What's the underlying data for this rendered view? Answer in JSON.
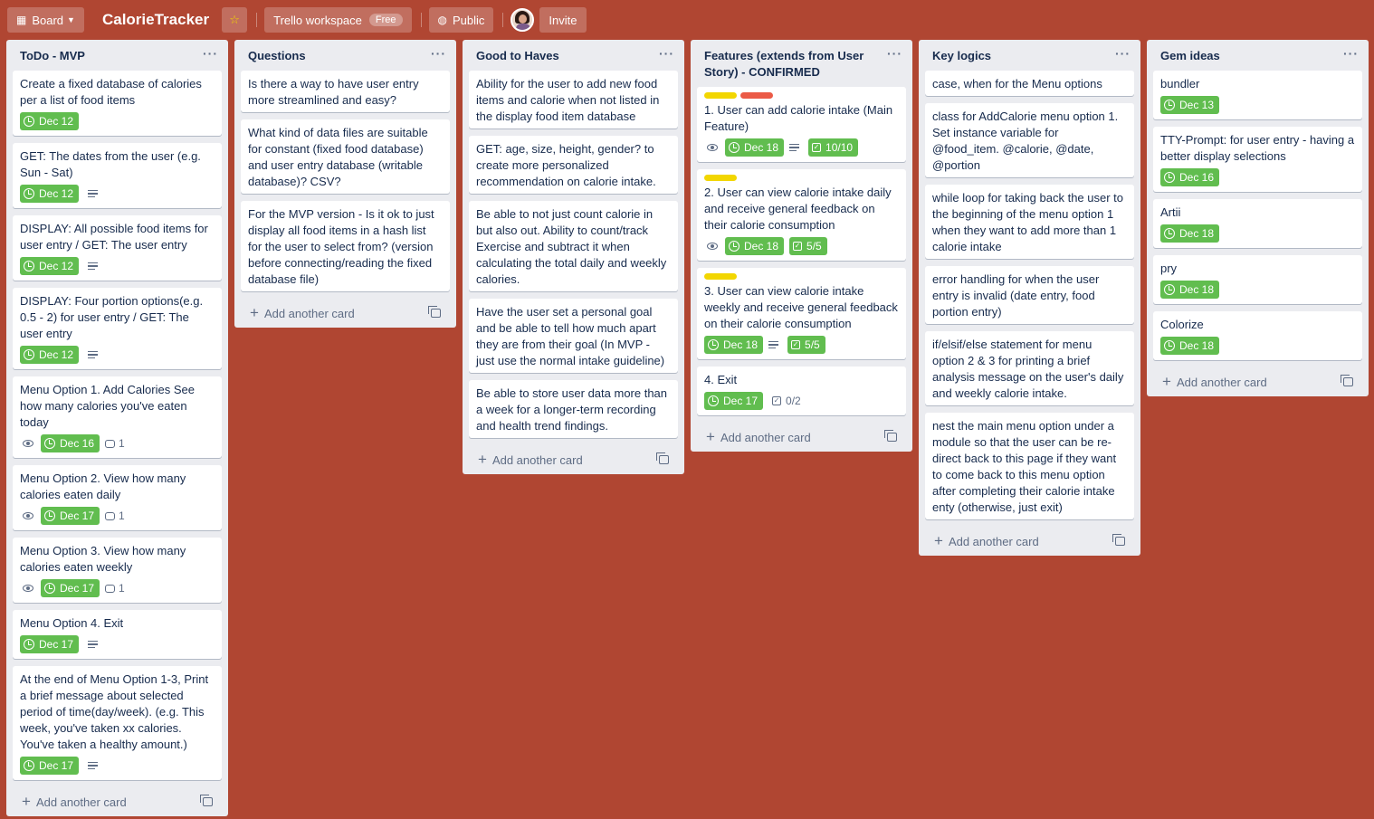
{
  "header": {
    "board_btn": "Board",
    "title": "CalorieTracker",
    "workspace": "Trello workspace",
    "workspace_badge": "Free",
    "visibility": "Public",
    "invite": "Invite"
  },
  "lists": [
    {
      "title": "ToDo - MVP",
      "add": "Add another card",
      "cards": [
        {
          "text": "Create a fixed database of calories per a list of food items",
          "due": "Dec 12"
        },
        {
          "text": "GET: The dates from the user (e.g. Sun - Sat)",
          "due": "Dec 12"
        },
        {
          "text": "DISPLAY: All possible food items for user entry / GET: The user entry",
          "due": "Dec 12"
        },
        {
          "text": "DISPLAY: Four portion options(e.g. 0.5 - 2) for user entry / GET: The user entry",
          "due": "Dec 12"
        },
        {
          "text": "Menu Option 1. Add Calories See how many calories you've eaten today",
          "due": "Dec 16",
          "comments": "1"
        },
        {
          "text": "Menu Option 2. View how many calories eaten daily",
          "due": "Dec 17",
          "comments": "1"
        },
        {
          "text": "Menu Option 3. View how many calories eaten weekly",
          "due": "Dec 17",
          "comments": "1"
        },
        {
          "text": "Menu Option 4. Exit",
          "due": "Dec 17"
        },
        {
          "text": "At the end of Menu Option 1-3, Print a brief message about selected period of time(day/week). (e.g. This week, you've taken xx calories. You've taken a healthy amount.)",
          "due": "Dec 17"
        }
      ]
    },
    {
      "title": "Questions",
      "add": "Add another card",
      "cards": [
        {
          "text": "Is there a way to have user entry more streamlined and easy?"
        },
        {
          "text": "What kind of data files are suitable for constant (fixed food database) and user entry database (writable database)? CSV?"
        },
        {
          "text": "For the MVP version - Is it ok to just display all food items in a hash list for the user to select from? (version before connecting/reading the fixed database file)"
        }
      ]
    },
    {
      "title": "Good to Haves",
      "add": "Add another card",
      "cards": [
        {
          "text": "Ability for the user to add new food items and calorie when not listed in the display food item database"
        },
        {
          "text": "GET: age, size, height, gender? to create more personalized recommendation on calorie intake."
        },
        {
          "text": "Be able to not just count calorie in but also out. Ability to count/track Exercise and subtract it when calculating the total daily and weekly calories."
        },
        {
          "text": "Have the user set a personal goal and be able to tell how much apart they are from their goal (In MVP - just use the normal intake guideline)"
        },
        {
          "text": "Be able to store user data more than a week for a longer-term recording and health trend findings."
        }
      ]
    },
    {
      "title": "Features (extends from User Story) - CONFIRMED",
      "add": "Add another card",
      "cards": [
        {
          "text": "1. User can add calorie intake (Main Feature)",
          "due": "Dec 18",
          "checklist": "10/10"
        },
        {
          "text": "2. User can view calorie intake daily and receive general feedback on their calorie consumption",
          "due": "Dec 18",
          "checklist": "5/5"
        },
        {
          "text": "3. User can view calorie intake weekly and receive general feedback on their calorie consumption",
          "due": "Dec 18",
          "checklist": "5/5"
        },
        {
          "text": "4. Exit",
          "due": "Dec 17",
          "checklist": "0/2"
        }
      ]
    },
    {
      "title": "Key logics",
      "add": "Add another card",
      "cards": [
        {
          "text": "case, when for the Menu options"
        },
        {
          "text": "class for AddCalorie menu option 1. Set instance variable for @food_item. @calorie, @date, @portion"
        },
        {
          "text": "while loop for taking back the user to the beginning of the menu option 1 when they want to add more than 1 calorie intake"
        },
        {
          "text": "error handling for when the user entry is invalid (date entry, food portion entry)"
        },
        {
          "text": "if/elsif/else statement for menu option 2 & 3 for printing a brief analysis message on the user's daily and weekly calorie intake."
        },
        {
          "text": "nest the main menu option under a module so that the user can be re-direct back to this page if they want to come back to this menu option after completing their calorie intake enty (otherwise, just exit)"
        }
      ]
    },
    {
      "title": "Gem ideas",
      "add": "Add another card",
      "cards": [
        {
          "text": "bundler",
          "due": "Dec 13"
        },
        {
          "text": "TTY-Prompt: for user entry - having a better display selections",
          "due": "Dec 16"
        },
        {
          "text": "Artii",
          "due": "Dec 18"
        },
        {
          "text": "pry",
          "due": "Dec 18"
        },
        {
          "text": "Colorize",
          "due": "Dec 18"
        }
      ]
    }
  ]
}
